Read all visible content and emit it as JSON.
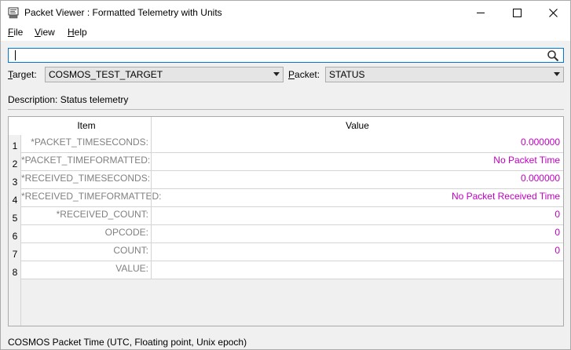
{
  "window": {
    "title": "Packet Viewer : Formatted Telemetry with Units",
    "icon": "monitor-icon"
  },
  "menu": {
    "file": {
      "first": "F",
      "rest": "ile"
    },
    "view": {
      "first": "V",
      "rest": "iew"
    },
    "help": {
      "first": "H",
      "rest": "elp"
    }
  },
  "search": {
    "value": "",
    "icon": "search-icon"
  },
  "selectors": {
    "target_label_first": "T",
    "target_label_rest": "arget:",
    "target_value": "COSMOS_TEST_TARGET",
    "packet_label_first": "P",
    "packet_label_rest": "acket:",
    "packet_value": "STATUS"
  },
  "description": "Description: Status telemetry",
  "table": {
    "headers": {
      "item": "Item",
      "value": "Value"
    },
    "rows": [
      {
        "num": "1",
        "item": "*PACKET_TIMESECONDS:",
        "value": "0.000000"
      },
      {
        "num": "2",
        "item": "*PACKET_TIMEFORMATTED:",
        "value": "No Packet Time"
      },
      {
        "num": "3",
        "item": "*RECEIVED_TIMESECONDS:",
        "value": "0.000000"
      },
      {
        "num": "4",
        "item": "*RECEIVED_TIMEFORMATTED:",
        "value": "No Packet Received Time"
      },
      {
        "num": "5",
        "item": "*RECEIVED_COUNT:",
        "value": "0"
      },
      {
        "num": "6",
        "item": "OPCODE:",
        "value": "0"
      },
      {
        "num": "7",
        "item": "COUNT:",
        "value": "0"
      },
      {
        "num": "8",
        "item": "VALUE:",
        "value": ""
      }
    ]
  },
  "status": "COSMOS Packet Time (UTC, Floating point, Unix epoch)",
  "colors": {
    "value_text": "#c000c0",
    "item_text": "#808080",
    "focus_border": "#0078d7"
  }
}
